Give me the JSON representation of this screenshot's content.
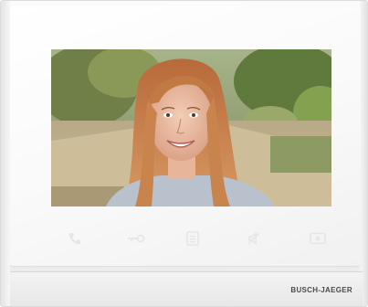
{
  "device": {
    "brand": "BUSCH-JAEGER"
  },
  "controls": [
    {
      "icon": "phone-icon"
    },
    {
      "icon": "key-icon"
    },
    {
      "icon": "menu-icon"
    },
    {
      "icon": "mute-icon"
    },
    {
      "icon": "video-icon"
    }
  ],
  "colors": {
    "bezel": "#f5f5f5",
    "icon": "#e6e6e6",
    "brand_text": "#4a4a4a"
  }
}
